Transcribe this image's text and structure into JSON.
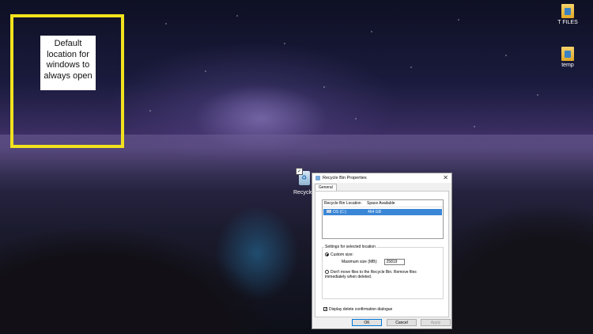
{
  "annotation": {
    "text_lines": [
      "Default",
      "location for",
      "windows to",
      "always open"
    ],
    "highlight_color": "#f1e21d"
  },
  "desktop": {
    "icons": [
      {
        "label": "T FILES",
        "icon": "folder-icon"
      },
      {
        "label": "temp",
        "icon": "folder-icon"
      },
      {
        "label": "Recycle",
        "icon": "recycle-bin-icon"
      }
    ]
  },
  "dialog": {
    "title": "Recycle Bin Properties",
    "close_glyph": "✕",
    "tabs": [
      {
        "label": "General"
      }
    ],
    "list": {
      "columns": [
        "Recycle Bin Location",
        "Space Available"
      ],
      "rows": [
        {
          "location": "OS (C:)",
          "space": "464 GB",
          "selected": true
        }
      ]
    },
    "settings_group_label": "Settings for selected location",
    "custom_size_label": "Custom size:",
    "max_size_label": "Maximum size (MB):",
    "max_size_value": "25819",
    "dont_move_label": "Don't move files to the Recycle Bin. Remove files immediately when deleted.",
    "display_confirm_label": "Display delete confirmation dialogue",
    "display_confirm_checked": true,
    "custom_size_selected": true,
    "buttons": {
      "ok": "OK",
      "cancel": "Cancel",
      "apply": "Apply"
    },
    "accent_color": "#3a86d6"
  }
}
